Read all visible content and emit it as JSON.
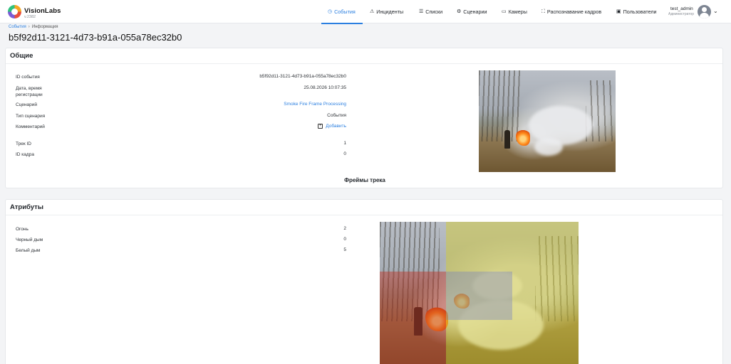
{
  "app": {
    "brand": "VisionLabs",
    "version": "v.2382"
  },
  "nav": [
    {
      "id": "events",
      "label": "События",
      "icon": "event-icon",
      "glyph": "◷",
      "active": true
    },
    {
      "id": "incidents",
      "label": "Инциденты",
      "icon": "alert-triangle-icon",
      "glyph": "⚠"
    },
    {
      "id": "lists",
      "label": "Списки",
      "icon": "list-icon",
      "glyph": "☰"
    },
    {
      "id": "scenarios",
      "label": "Сценарии",
      "icon": "scenario-icon",
      "glyph": "⚙"
    },
    {
      "id": "cameras",
      "label": "Камеры",
      "icon": "camera-icon",
      "glyph": "▭"
    },
    {
      "id": "recognition",
      "label": "Распознавание кадров",
      "icon": "frame-scan-icon",
      "glyph": "⛶"
    },
    {
      "id": "users",
      "label": "Пользователи",
      "icon": "users-icon",
      "glyph": "▣"
    }
  ],
  "user": {
    "name": "test_admin",
    "role": "Администратор",
    "avatar_icon": "user-avatar-icon"
  },
  "breadcrumb": {
    "root": "События",
    "current": "Информация"
  },
  "title": "b5f92d11-3121-4d73-b91a-055a78ec32b0",
  "general": {
    "header": "Общие",
    "rows": [
      {
        "label": "ID события",
        "value": "b5f92d11-3121-4d73-b91a-055a78ec32b0"
      },
      {
        "label": "Дата, время регистрации",
        "value": "25.08.2026 10:07:35"
      },
      {
        "label": "Сценарий",
        "value": "Smoke Fire Frame Processing",
        "link": true
      },
      {
        "label": "Тип сценария",
        "value": "События"
      },
      {
        "label": "Комментарий",
        "value": "Добавить",
        "action": true
      },
      {
        "label": "Трек ID",
        "value": "1"
      },
      {
        "label": "ID кадра",
        "value": "0"
      }
    ],
    "frames_title": "Фреймы трека"
  },
  "attributes": {
    "header": "Атрибуты",
    "rows": [
      {
        "label": "Огонь",
        "value": "2"
      },
      {
        "label": "Черный дым",
        "value": "0"
      },
      {
        "label": "Белый дым",
        "value": "5"
      }
    ]
  },
  "colors": {
    "accent": "#2b7fe0",
    "overlay_yellow": "rgba(214,206,40,0.45)",
    "overlay_red": "rgba(190,50,35,0.45)",
    "overlay_blue": "rgba(110,120,200,0.35)"
  }
}
